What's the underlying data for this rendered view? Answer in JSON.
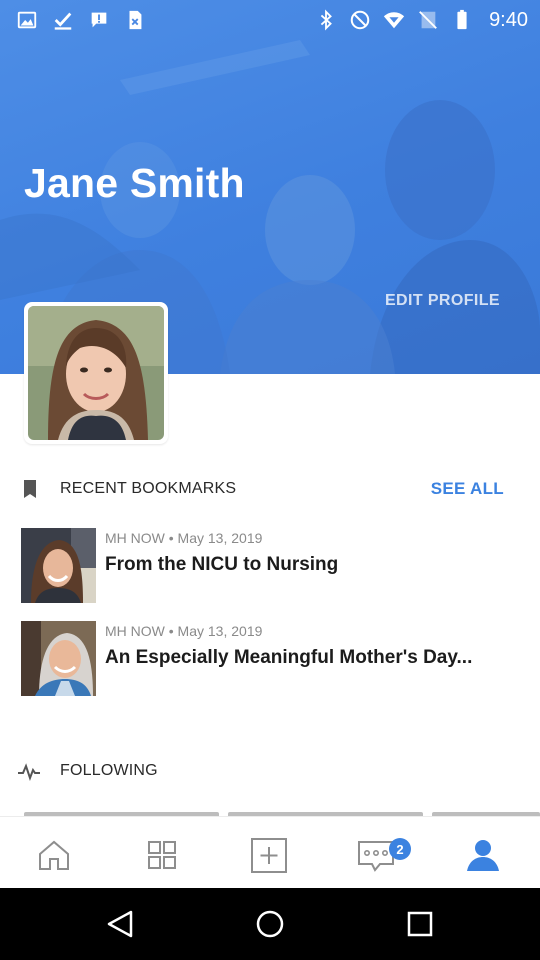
{
  "status_bar": {
    "time": "9:40",
    "left_icons": [
      "image-icon",
      "check-icon",
      "chat-alert-icon",
      "doc-close-icon"
    ],
    "right_icons": [
      "bluetooth-icon",
      "do-not-disturb-icon",
      "wifi-icon",
      "no-sim-icon",
      "battery-icon"
    ]
  },
  "profile": {
    "name": "Jane Smith",
    "edit_label": "EDIT PROFILE"
  },
  "bookmarks": {
    "title": "RECENT BOOKMARKS",
    "see_all": "SEE ALL",
    "items": [
      {
        "source": "MH NOW",
        "date": "May 13, 2019",
        "meta": "MH NOW • May 13, 2019",
        "title": "From the NICU to Nursing"
      },
      {
        "source": "MH NOW",
        "date": "May 13, 2019",
        "meta": "MH NOW • May 13, 2019",
        "title": "An Especially Meaningful Mother's Day..."
      }
    ]
  },
  "following": {
    "title": "FOLLOWING"
  },
  "tabbar": {
    "tabs": [
      "home-icon",
      "grid-icon",
      "add-icon",
      "messages-icon",
      "profile-icon"
    ],
    "active": "profile-icon",
    "messages_badge": "2"
  },
  "colors": {
    "accent": "#3b82e0",
    "hero": "#4a88e3"
  }
}
